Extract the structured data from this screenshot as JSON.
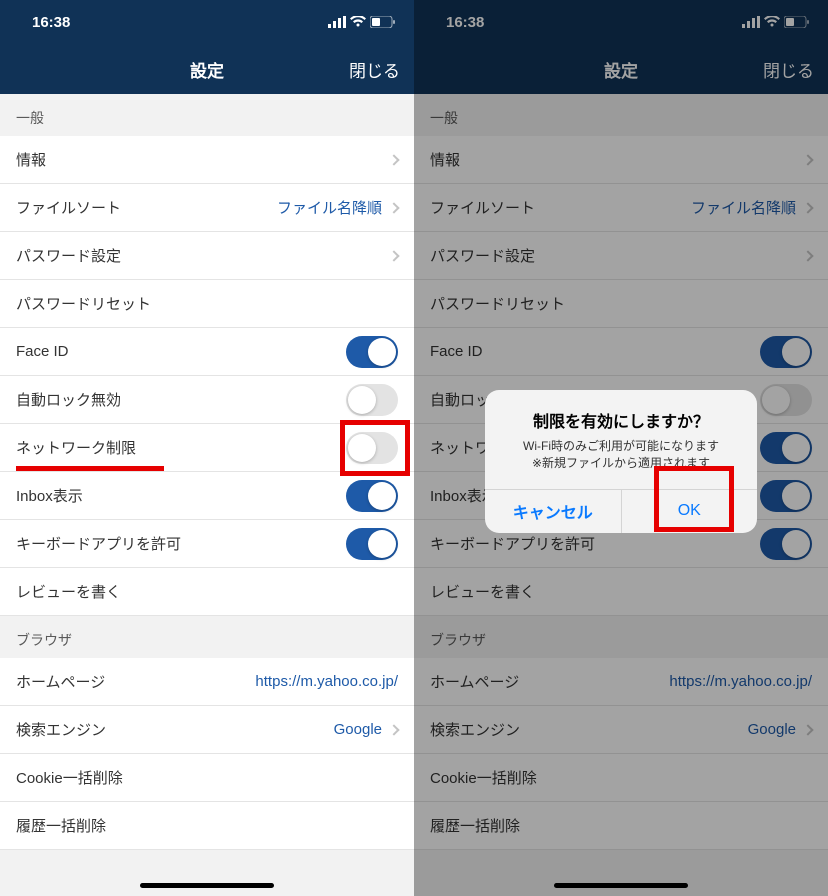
{
  "status": {
    "time": "16:38"
  },
  "nav": {
    "title": "設定",
    "close": "閉じる"
  },
  "sections": {
    "general_header": "一般",
    "browser_header": "ブラウザ"
  },
  "rows": {
    "info": "情報",
    "filesort_label": "ファイルソート",
    "filesort_value": "ファイル名降順",
    "password_settings": "パスワード設定",
    "password_reset": "パスワードリセット",
    "faceid": "Face ID",
    "autolock": "自動ロック無効",
    "network_limit": "ネットワーク制限",
    "inbox": "Inbox表示",
    "keyboard_allow": "キーボードアプリを許可",
    "write_review": "レビューを書く",
    "homepage_label": "ホームページ",
    "homepage_value": "https://m.yahoo.co.jp/",
    "search_engine_label": "検索エンジン",
    "search_engine_value": "Google",
    "cookie_clear": "Cookie一括削除",
    "history_clear": "履歴一括削除"
  },
  "toggles": {
    "faceid": true,
    "autolock": false,
    "network_limit_left": false,
    "network_limit_right": true,
    "inbox": true,
    "keyboard_allow": true
  },
  "alert": {
    "title": "制限を有効にしますか？",
    "line1": "Wi-Fi時のみご利用が可能になります",
    "line2": "※新規ファイルから適用されます",
    "cancel": "キャンセル",
    "ok": "OK"
  }
}
